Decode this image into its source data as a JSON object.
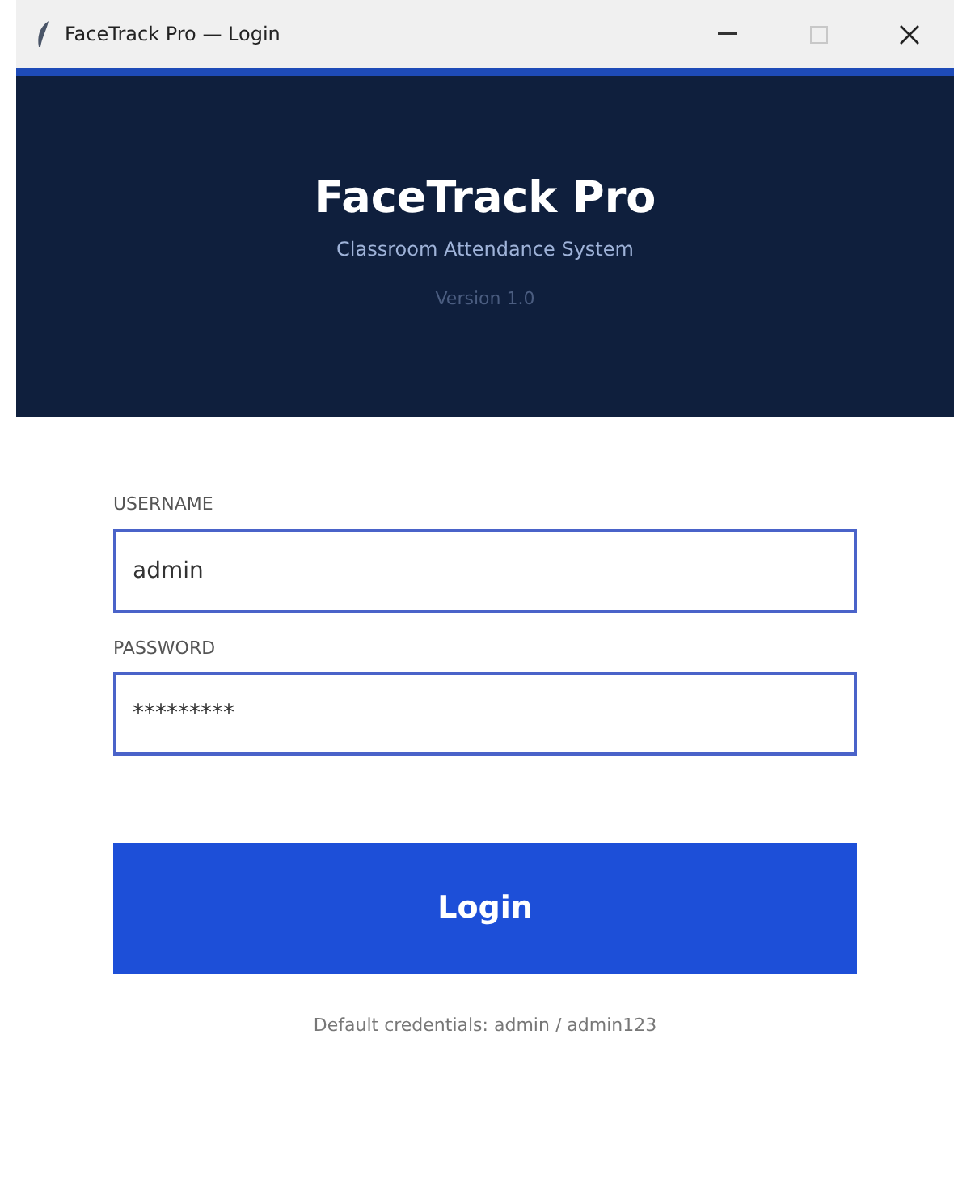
{
  "window": {
    "title": "FaceTrack Pro — Login"
  },
  "header": {
    "title": "FaceTrack Pro",
    "subtitle": "Classroom Attendance System",
    "version": "Version 1.0"
  },
  "fields": [
    {
      "label": "USERNAME",
      "value": "admin"
    },
    {
      "label": "PASSWORD",
      "value": "*********"
    }
  ],
  "login_button": "Login",
  "hint": "Default credentials: admin / admin123"
}
